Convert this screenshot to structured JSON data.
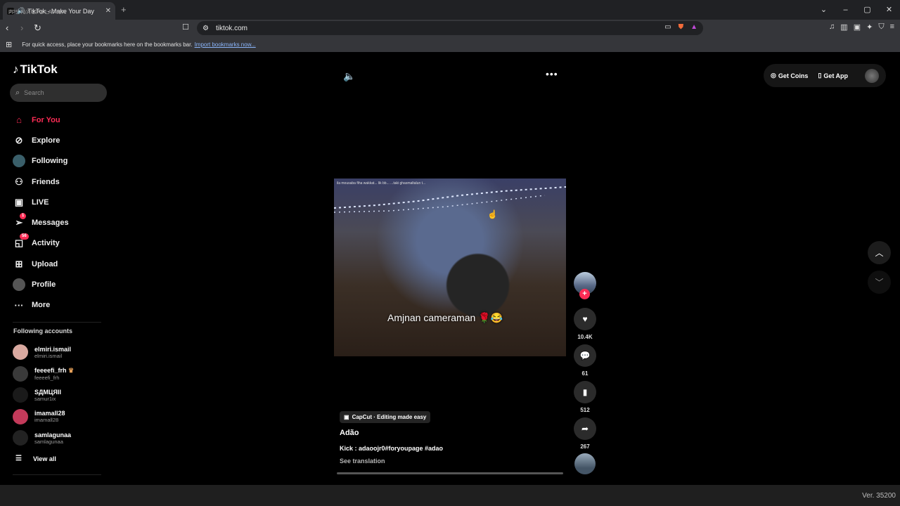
{
  "browser": {
    "tab_title": "TikTok - Make Your Day",
    "overlay": "FPS N/A    CPU    LAT N/A",
    "url": "tiktok.com",
    "bookmarks_text": "For quick access, place your bookmarks here on the bookmarks bar.",
    "bookmarks_link": "Import bookmarks now..."
  },
  "sidebar": {
    "logo": "TikTok",
    "search_placeholder": "Search",
    "nav": [
      {
        "label": "For You",
        "icon": "home-icon",
        "active": true
      },
      {
        "label": "Explore",
        "icon": "compass-icon"
      },
      {
        "label": "Following",
        "icon": "following-avatar-icon"
      },
      {
        "label": "Friends",
        "icon": "friends-icon"
      },
      {
        "label": "LIVE",
        "icon": "live-icon"
      },
      {
        "label": "Messages",
        "icon": "messages-icon",
        "badge": "1"
      },
      {
        "label": "Activity",
        "icon": "activity-icon",
        "badge": "56"
      },
      {
        "label": "Upload",
        "icon": "upload-icon"
      },
      {
        "label": "Profile",
        "icon": "profile-avatar-icon"
      },
      {
        "label": "More",
        "icon": "more-icon"
      }
    ],
    "following_title": "Following accounts",
    "accounts": [
      {
        "name": "elmiri.ismail",
        "handle": "elmiri.ismail",
        "color": "#d9a9a0"
      },
      {
        "name": "feeeefi_frh",
        "handle": "feeeefi_frh",
        "color": "#3a3a3a"
      },
      {
        "name": "SДМЦЯII",
        "handle": "samur1ix",
        "color": "#1a1a1a"
      },
      {
        "name": "imamall28",
        "handle": "imamall28",
        "color": "#c33a5a"
      },
      {
        "name": "samlagunaa",
        "handle": "samlagunaa",
        "color": "#222222"
      }
    ],
    "view_all": "View all"
  },
  "header": {
    "get_coins": "Get Coins",
    "get_app": "Get App"
  },
  "video": {
    "caption_top": "ila mousaba fiha wakkat... lik bb... ...taki ghasmaltalun t...",
    "caption": "Amjnan cameraman 🌹😂",
    "capcut": "CapCut · Editing made easy",
    "author": "Adão",
    "description": "Kick : adaoojr0#foryoupage #adao",
    "see_translation": "See translation",
    "likes": "10.4K",
    "comments": "61",
    "saves": "512",
    "shares": "267"
  },
  "footer": {
    "version": "Ver. 35200"
  },
  "colors": {
    "accent": "#fe2c55",
    "background": "#000000"
  }
}
